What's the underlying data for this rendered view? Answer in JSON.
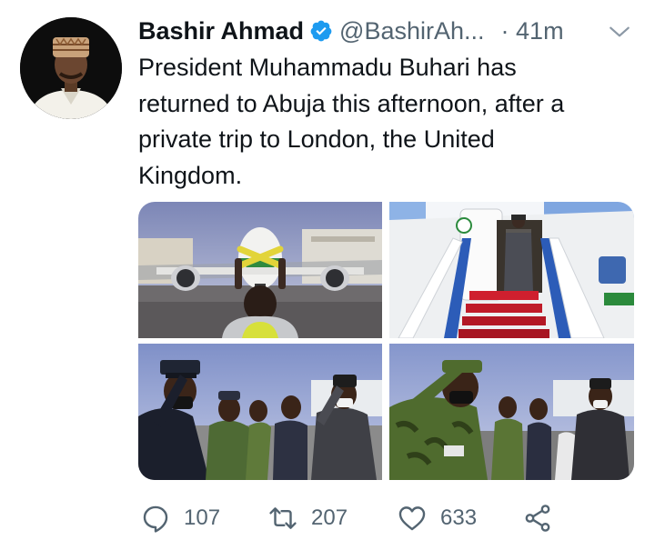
{
  "tweet": {
    "author_name": "Bashir Ahmad",
    "handle": "@BashirAh...",
    "separator": "·",
    "time": "41m",
    "text_lines": [
      "President Muhammadu Buhari has",
      "returned to Abuja this afternoon, after a",
      "private trip to London, the United",
      "Kingdom."
    ],
    "photos": [
      {
        "name": "photo-airport-marshal"
      },
      {
        "name": "photo-aircraft-stairs"
      },
      {
        "name": "photo-police-salute"
      },
      {
        "name": "photo-military-salute"
      }
    ]
  },
  "actions": {
    "replies": "107",
    "retweets": "207",
    "likes": "633"
  },
  "colors": {
    "verified_blue": "#1d9bf0",
    "muted_text": "#536471"
  },
  "icons": [
    "verified-badge-icon",
    "chevron-down-icon",
    "reply-icon",
    "retweet-icon",
    "like-icon",
    "share-icon"
  ]
}
